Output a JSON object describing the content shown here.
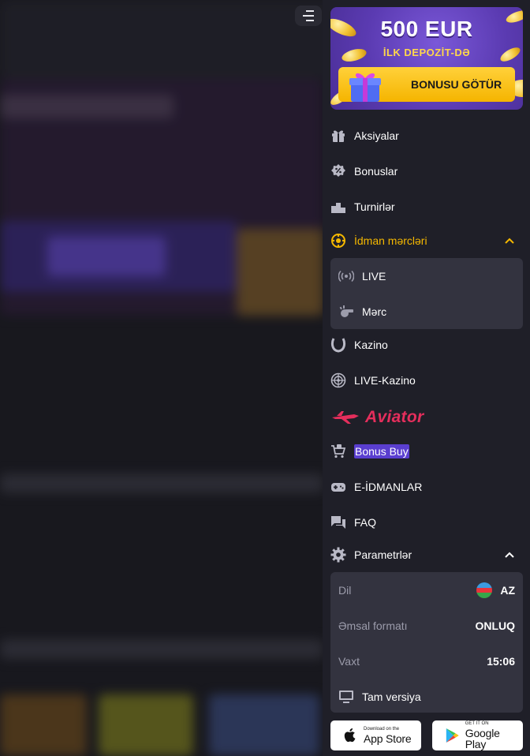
{
  "promo": {
    "amount": "500 EUR",
    "subtitle": "İLK DEPOZİT-DƏ",
    "button_label": "BONUSU GÖTÜR"
  },
  "nav": {
    "items": [
      {
        "label": "Aksiyalar",
        "icon": "gift-icon"
      },
      {
        "label": "Bonuslar",
        "icon": "percent-badge-icon"
      },
      {
        "label": "Turnirlər",
        "icon": "podium-icon"
      },
      {
        "label": "İdman mərcləri",
        "icon": "sports-ball-icon",
        "expanded": true,
        "color": "#f5b800"
      },
      {
        "label": "Kazino",
        "icon": "horseshoe-icon"
      },
      {
        "label": "LIVE-Kazino",
        "icon": "roulette-icon"
      },
      {
        "label": "Bonus Buy",
        "icon": "cart-icon"
      },
      {
        "label": "E-İDMANLAR",
        "icon": "gamepad-icon"
      },
      {
        "label": "FAQ",
        "icon": "chat-icon"
      },
      {
        "label": "Parametrlər",
        "icon": "gear-icon",
        "expanded": true
      }
    ],
    "sports_sub": [
      {
        "label": "LIVE",
        "icon": "broadcast-icon"
      },
      {
        "label": "Mərc",
        "icon": "whistle-icon"
      }
    ],
    "aviator_label": "Aviator"
  },
  "settings": {
    "language_label": "Dil",
    "language_value": "AZ",
    "odds_label": "Əmsal formatı",
    "odds_value": "ONLUQ",
    "time_label": "Vaxt",
    "time_value": "15:06",
    "full_version_label": "Tam versiya"
  },
  "stores": {
    "apple_small": "Download on the",
    "apple_big": "App Store",
    "google_small": "GET IT ON",
    "google_big": "Google Play"
  },
  "colors": {
    "panel_bg": "#1f1f28",
    "accent": "#f5b800",
    "promo_purple": "#5b3bb2",
    "aviator_red": "#e52e5c"
  }
}
